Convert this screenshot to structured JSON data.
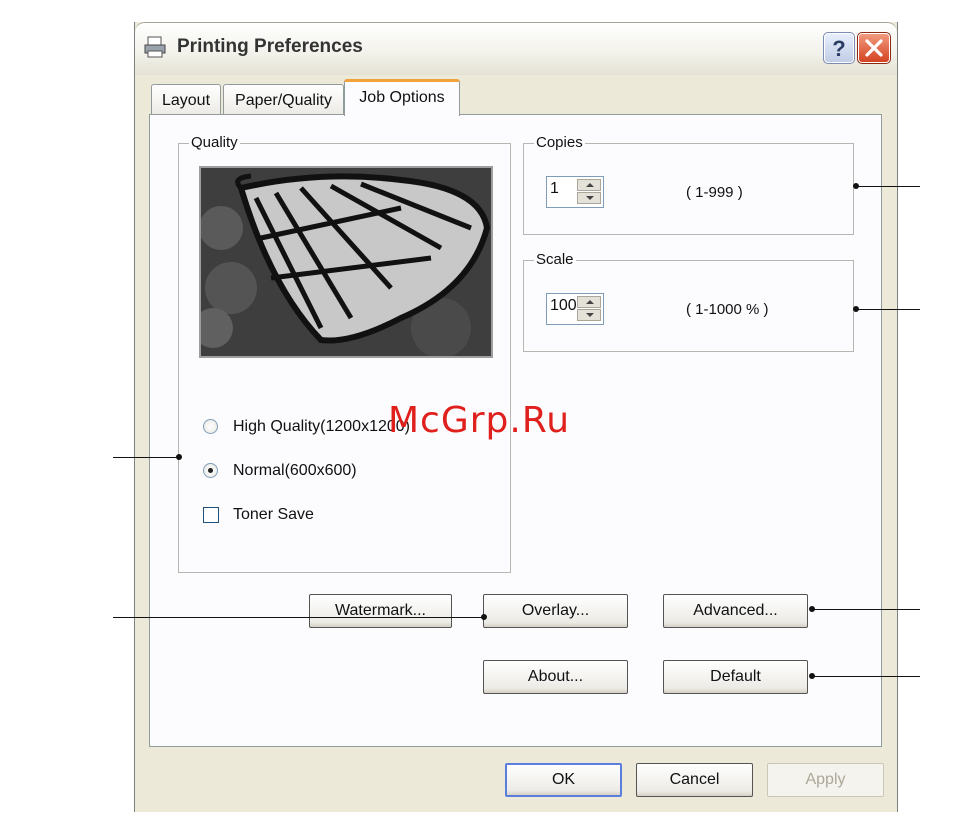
{
  "window": {
    "title": "Printing Preferences",
    "help_label": "?"
  },
  "tabs": [
    {
      "label": "Layout",
      "active": false
    },
    {
      "label": "Paper/Quality",
      "active": false
    },
    {
      "label": "Job Options",
      "active": true
    }
  ],
  "quality": {
    "legend": "Quality",
    "options": [
      {
        "label": "High Quality(1200x1200)",
        "type": "radio",
        "checked": false
      },
      {
        "label": "Normal(600x600)",
        "type": "radio",
        "checked": true
      },
      {
        "label": "Toner Save",
        "type": "checkbox",
        "checked": false
      }
    ]
  },
  "copies": {
    "legend": "Copies",
    "value": "1",
    "range": "( 1-999 )"
  },
  "scale": {
    "legend": "Scale",
    "value": "100",
    "range": "( 1-1000 % )"
  },
  "buttons": {
    "watermark": "Watermark...",
    "overlay": "Overlay...",
    "advanced": "Advanced...",
    "about": "About...",
    "default": "Default",
    "ok": "OK",
    "cancel": "Cancel",
    "apply": "Apply"
  },
  "overlay_text": "McGrp.Ru",
  "colors": {
    "accent_tab": "#f2a23a",
    "close_red": "#d44322",
    "window_bg": "#ece9d8",
    "watermark_red": "#e0201c"
  }
}
